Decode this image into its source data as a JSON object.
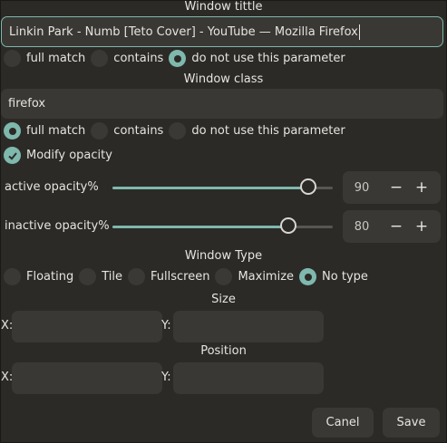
{
  "window_title": {
    "heading": "Window tittle",
    "value": "Linkin Park - Numb [Teto Cover] - YouTube — Mozilla Firefox",
    "options": [
      "full match",
      "contains",
      "do not use this parameter"
    ],
    "selected": 2
  },
  "window_class": {
    "heading": "Window class",
    "value": "firefox",
    "options": [
      "full match",
      "contains",
      "do not use this parameter"
    ],
    "selected": 0
  },
  "modify_opacity": {
    "label": "Modify opacity",
    "checked": true
  },
  "active_opacity": {
    "label": "active opacity%",
    "value": "90",
    "minus": "−",
    "plus": "+"
  },
  "inactive_opacity": {
    "label": "inactive opacity%",
    "value": "80",
    "minus": "−",
    "plus": "+"
  },
  "window_type": {
    "heading": "Window Type",
    "options": [
      "Floating",
      "Tile",
      "Fullscreen",
      "Maximize",
      "No type"
    ],
    "selected": 4
  },
  "size": {
    "heading": "Size",
    "x_label": "X:",
    "y_label": "Y:",
    "x_value": "",
    "y_value": ""
  },
  "position": {
    "heading": "Position",
    "x_label": "X:",
    "y_label": "Y:",
    "x_value": "",
    "y_value": ""
  },
  "footer": {
    "cancel": "Canel",
    "save": "Save"
  },
  "colors": {
    "background": "#2b2a27",
    "accent": "#7fb8ad",
    "field": "#3a3834"
  }
}
